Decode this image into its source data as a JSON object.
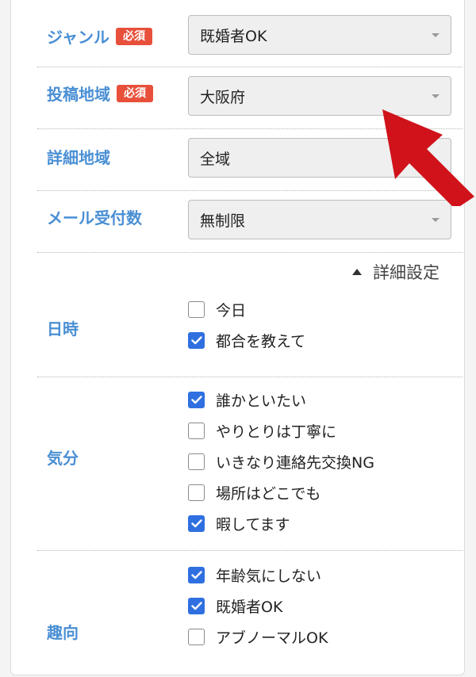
{
  "form": {
    "required_badge": "必須",
    "genre": {
      "label": "ジャンル",
      "value": "既婚者OK"
    },
    "area": {
      "label": "投稿地域",
      "value": "大阪府"
    },
    "detail_area": {
      "label": "詳細地域",
      "value": "全域"
    },
    "mail_limit": {
      "label": "メール受付数",
      "value": "無制限"
    }
  },
  "advanced": {
    "toggle_label": "詳細設定"
  },
  "datetime": {
    "label": "日時",
    "options": [
      {
        "label": "今日",
        "checked": false
      },
      {
        "label": "都合を教えて",
        "checked": true
      }
    ]
  },
  "mood": {
    "label": "気分",
    "options": [
      {
        "label": "誰かといたい",
        "checked": true
      },
      {
        "label": "やりとりは丁寧に",
        "checked": false
      },
      {
        "label": "いきなり連絡先交換NG",
        "checked": false
      },
      {
        "label": "場所はどこでも",
        "checked": false
      },
      {
        "label": "暇してます",
        "checked": true
      }
    ]
  },
  "preference": {
    "label": "趣向",
    "options": [
      {
        "label": "年齢気にしない",
        "checked": true
      },
      {
        "label": "既婚者OK",
        "checked": true
      },
      {
        "label": "アブノーマルOK",
        "checked": false
      }
    ]
  },
  "colors": {
    "label_blue": "#4a8fd4",
    "badge_red": "#e8503b",
    "checkbox_blue": "#2f6fe0",
    "arrow_red": "#d0121b"
  }
}
